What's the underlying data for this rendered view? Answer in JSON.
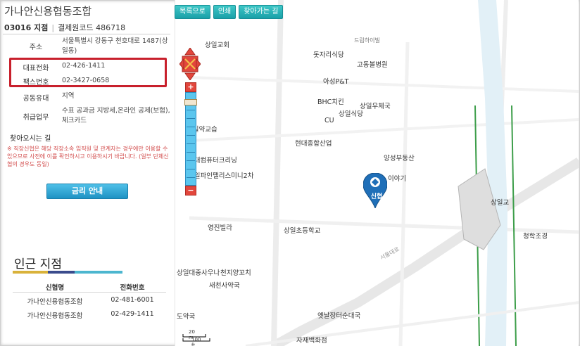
{
  "branch": {
    "title": "가나안신용협동조합",
    "branch_code": "03016 지점",
    "settlement_code": "결제원코드 486718"
  },
  "info": {
    "address_label": "주소",
    "address_value": "서울특별시 강동구 천호대로 1487(상일동)",
    "phone_label": "대표전화",
    "phone_value": "02-426-1411",
    "fax_label": "팩스번호",
    "fax_value": "02-3427-0658",
    "bond_label": "공동유대",
    "bond_value": "지역",
    "services_label": "취급업무",
    "services_value": "수표 공과금 지방세,온라인 공제(보험),체크카드",
    "howto_label": "찾아오시는 길",
    "notice": "※ 직장신협은 해당 직장소속 임직원 및 관계자는 경우에만 이용할 수 있으므로 사전에 이를 확인하시고 이용하시기 바랍니다. (일부 단체신협의 경우도 동일)"
  },
  "rate_button": "금리 안내",
  "nearby": {
    "title": "인근 지점",
    "bar_colors": [
      "#d9b23a",
      "#3a4b8c",
      "#4cb6cf"
    ],
    "headers": {
      "name": "신협명",
      "phone": "전화번호"
    },
    "rows": [
      {
        "name": "가나안신용협동조합",
        "phone": "02-481-6001"
      },
      {
        "name": "가나안신용협동조합",
        "phone": "02-429-1411"
      }
    ]
  },
  "toolbar": {
    "list": "목록으로",
    "print": "인쇄",
    "directions": "찾아가는 길"
  },
  "map": {
    "pin_label": "신협",
    "scale_small": "20 m",
    "scale_large": "100 ft",
    "labels": [
      "상일교회",
      "드림하이빌",
      "돗자리식당",
      "고동볼병원",
      "아성P&T",
      "BHC치킨",
      "상일우체국",
      "상일식당",
      "CU",
      "상일약교습",
      "현대종합산업",
      "양성부동산",
      "현대컴퓨터크리닝",
      "상일파인팰리스미니2차",
      "이야기",
      "상일교",
      "영진빌라",
      "상일초등학교",
      "청학조경",
      "상일대중사우나",
      "천지양꼬치",
      "새천사약국",
      "도약국",
      "옛날장터순대국",
      "자재백화점",
      "서울대로"
    ]
  }
}
